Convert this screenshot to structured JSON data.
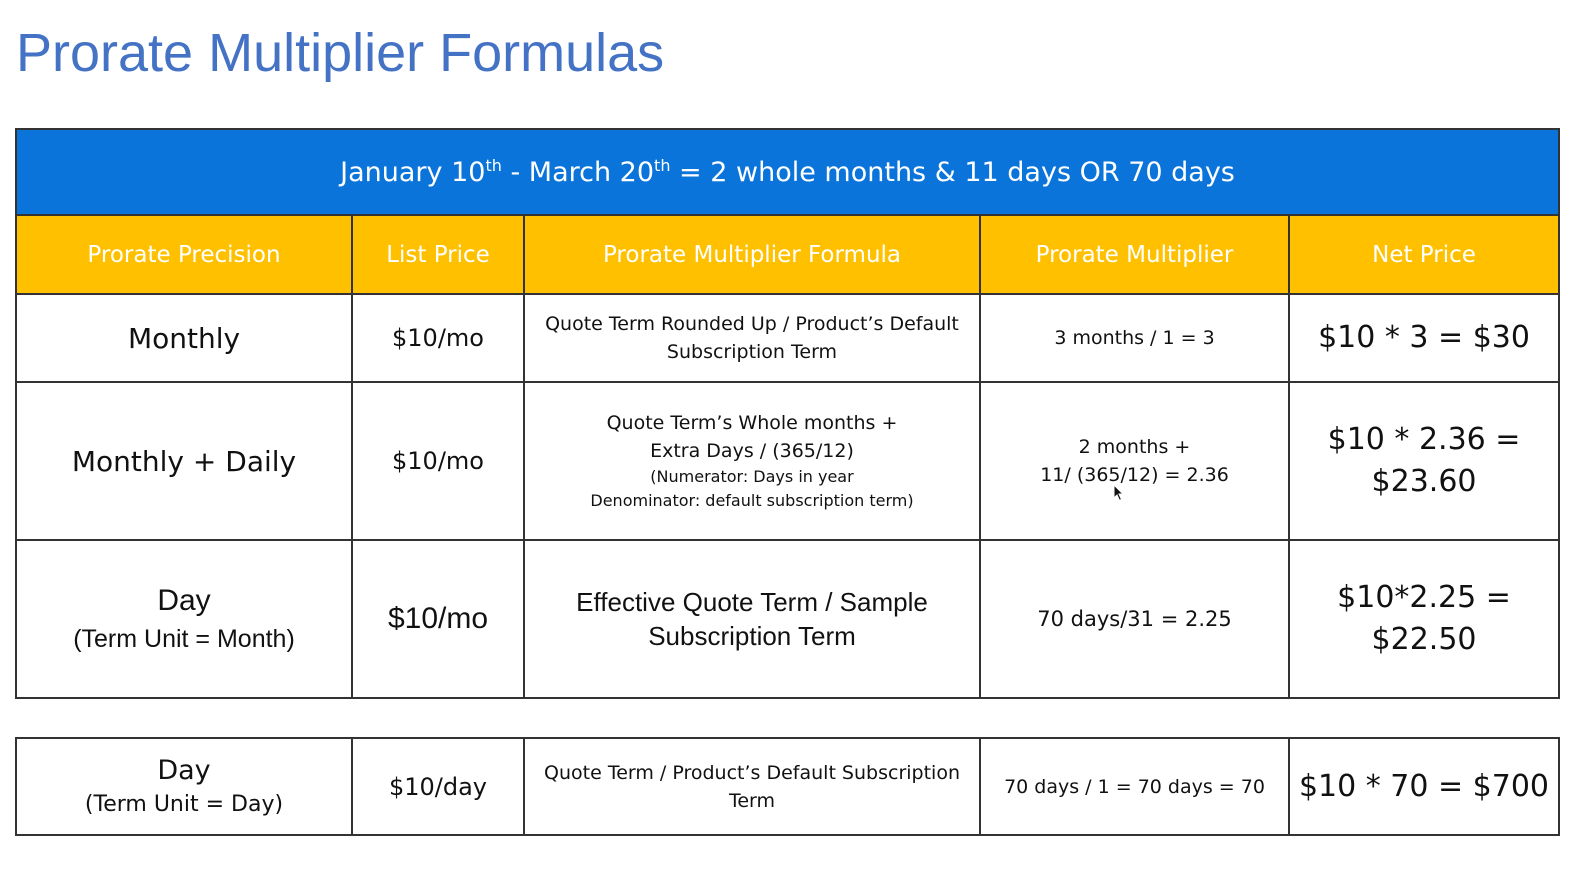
{
  "title": "Prorate Multiplier Formulas",
  "colors": {
    "title": "#4472c4",
    "banner": "#0a74da",
    "header": "#ffc000"
  },
  "banner": {
    "start_month": "January 10",
    "start_sup": "th",
    "separator": " - ",
    "end_month": "March 20",
    "end_sup": "th",
    "rest": " = 2 whole months & 11 days  OR 70 days"
  },
  "headers": [
    "Prorate Precision",
    "List Price",
    "Prorate Multiplier Formula",
    "Prorate Multiplier",
    "Net Price"
  ],
  "rows": [
    {
      "precision": "Monthly",
      "precision_sub": "",
      "list_price": "$10/mo",
      "formula_lines": [
        "Quote Term Rounded Up / Product’s Default",
        "Subscription Term"
      ],
      "formula_notes": [],
      "multiplier_lines": [
        "3 months / 1 = 3"
      ],
      "net_lines": [
        "$10 * 3 = $30"
      ]
    },
    {
      "precision": "Monthly + Daily",
      "precision_sub": "",
      "list_price": "$10/mo",
      "formula_lines": [
        "Quote Term’s Whole months +",
        "Extra Days / (365/12)"
      ],
      "formula_notes": [
        "(Numerator: Days in year",
        "Denominator: default subscription term)"
      ],
      "multiplier_lines": [
        "2 months +",
        "11/ (365/12) = 2.36"
      ],
      "net_lines": [
        "$10 * 2.36 =",
        "$23.60"
      ]
    },
    {
      "precision": "Day",
      "precision_sub": "(Term Unit = Month)",
      "list_price": "$10/mo",
      "formula_lines": [
        "Effective Quote Term / Sample",
        "Subscription Term"
      ],
      "formula_notes": [],
      "multiplier_lines": [
        "70 days/31 = 2.25"
      ],
      "net_lines": [
        "$10*2.25 =",
        "$22.50"
      ]
    },
    {
      "precision": "Day",
      "precision_sub": "(Term Unit = Day)",
      "list_price": "$10/day",
      "formula_lines": [
        "Quote Term / Product’s Default Subscription",
        "Term"
      ],
      "formula_notes": [],
      "multiplier_lines": [
        "70 days / 1 = 70 days = 70"
      ],
      "net_lines": [
        "$10 * 70 = $700"
      ]
    }
  ]
}
